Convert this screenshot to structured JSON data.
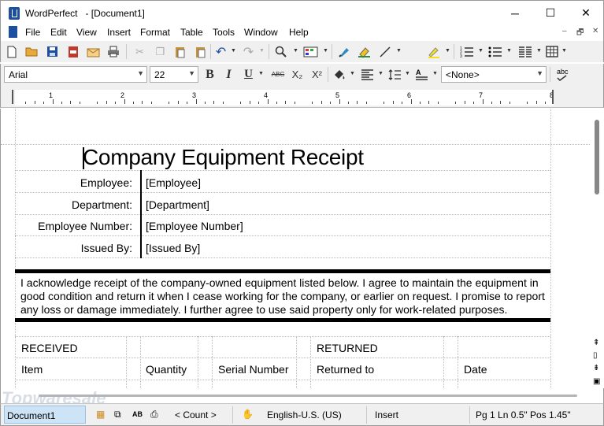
{
  "window": {
    "title": "WordPerfect   - [Document1]",
    "controls": {
      "minimize": "─",
      "maximize": "☐",
      "close": "✕"
    }
  },
  "menu": {
    "items": [
      "File",
      "Edit",
      "View",
      "Insert",
      "Format",
      "Table",
      "Tools",
      "Window",
      "Help"
    ],
    "mdi_controls": {
      "minimize": "–",
      "restore": "🗗",
      "close": "✕"
    }
  },
  "toolbar": {
    "font_name": "Arial",
    "font_size": "22",
    "bold": "B",
    "italic": "I",
    "underline": "U",
    "strikethrough": "ABC",
    "subscript": "X₂",
    "superscript": "X²",
    "style": "<None>",
    "icons": [
      "new-icon",
      "open-icon",
      "save-icon",
      "pdf-icon",
      "email-icon",
      "print-icon",
      "cut-icon",
      "copy-icon",
      "paste-icon",
      "paste-special-icon",
      "undo-icon",
      "redo-icon",
      "zoom-icon",
      "insert-icon",
      "format-painter-icon",
      "highlight-icon",
      "line-icon",
      "marker-icon",
      "numbering-icon",
      "bullets-icon",
      "columns-icon",
      "table-icon",
      "fill-icon",
      "justify-icon",
      "line-spacing-icon",
      "paragraph-style-icon",
      "spellcheck-icon"
    ]
  },
  "ruler": {
    "numbers": [
      "1",
      "2",
      "3",
      "4",
      "5",
      "6",
      "7",
      "8"
    ]
  },
  "document": {
    "title": "Company Equipment Receipt",
    "fields": [
      {
        "label": "Employee:",
        "value": "[Employee]"
      },
      {
        "label": "Department:",
        "value": "[Department]"
      },
      {
        "label": "Employee Number:",
        "value": "[Employee Number]"
      },
      {
        "label": "Issued By:",
        "value": "[Issued By]"
      }
    ],
    "paragraph": "I acknowledge receipt of the company-owned equipment listed below.  I agree to maintain the equipment in good condition and return it when I cease working for the company, or earlier on request.  I promise to report any loss or damage immediately.  I further agree to use said property only for work-related purposes.",
    "table": {
      "received_header": "RECEIVED",
      "returned_header": "RETURNED",
      "columns": [
        "Item",
        "Quantity",
        "Serial Number",
        "Returned to",
        "Date"
      ]
    }
  },
  "statusbar": {
    "document": "Document1",
    "count": "< Count >",
    "language": "English-U.S. (US)",
    "mode": "Insert",
    "position": "Pg 1 Ln 0.5\" Pos 1.45\""
  },
  "watermark": "Topwaresale"
}
